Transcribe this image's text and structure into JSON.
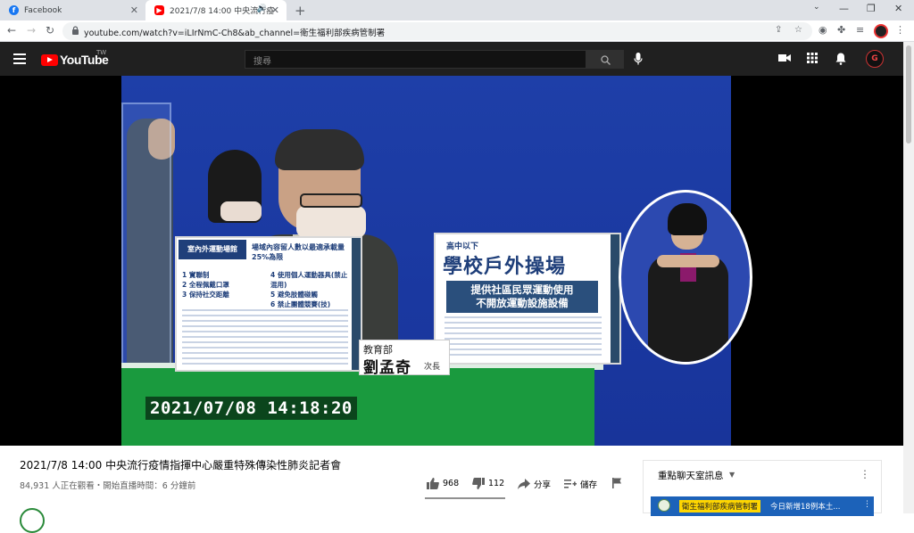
{
  "browser": {
    "tabs": [
      {
        "label": "Facebook",
        "favicon": "facebook-icon",
        "color": "#1877f2"
      },
      {
        "label": "2021/7/8 14:00 中央流行疫",
        "favicon": "youtube-icon",
        "color": "#ff0000"
      }
    ],
    "new_tab": "+",
    "url": "youtube.com/watch?v=iLIrNmC-Ch8&ab_channel=衛生福利部疾病管制署"
  },
  "youtube": {
    "logo_text": "YouTube",
    "country_code": "TW",
    "search_placeholder": "搜尋"
  },
  "video": {
    "board1": {
      "header": "室內外運動場館",
      "title": "場域內容留人數以最適承載量25%為限",
      "items": [
        "1 實聯制",
        "2 全程佩戴口罩",
        "3 保持社交距離",
        "4 使用個人運動器具(禁止混用)",
        "5 避免肢體碰觸",
        "6 禁止團體競賽(技)"
      ]
    },
    "board2": {
      "top": "高中以下",
      "title": "學校戶外操場",
      "subtitle_line1": "提供社區民眾運動使用",
      "subtitle_line2": "不開放運動設施設備"
    },
    "nameplate": {
      "org": "教育部",
      "name": "劉孟奇",
      "title": "次長"
    },
    "timestamp": "2021/07/08  14:18:20"
  },
  "below": {
    "title": "2021/7/8 14:00 中央流行疫情指揮中心嚴重特殊傳染性肺炎記者會",
    "meta": "84,931 人正在觀看・開始直播時間：6 分鐘前",
    "likes": "968",
    "dislikes": "112",
    "share": "分享",
    "save": "儲存"
  },
  "chat": {
    "title": "重點聊天室訊息",
    "pinned_channel": "衛生福利部疾病管制署",
    "pinned_text": "今日新增18例本土..."
  },
  "colors": {
    "youtube_red": "#ff0000",
    "masthead": "#202020",
    "stage_blue": "#1e3fa8",
    "desk_green": "#1a9a3e",
    "chat_pin_blue": "#1c62b9"
  }
}
